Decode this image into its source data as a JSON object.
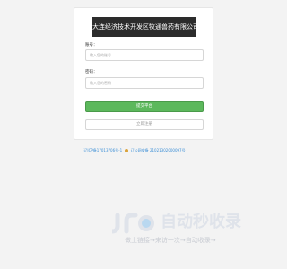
{
  "company_title": "大连经济技术开发区牧通兽药有限公司",
  "form": {
    "account_label": "账号：",
    "account_placeholder": "输入您的账号",
    "password_label": "密码：",
    "password_placeholder": "输入您的密码",
    "submit_label": "提交平台",
    "account_button_label": "立即注册"
  },
  "footer": {
    "icp_text": "辽ICP备17013706号-1",
    "police_text": "辽公网安备 21021302000097号"
  },
  "watermark": {
    "title": "自动秒收录",
    "subtitle": "做上链接→来访一次→自动收录→"
  },
  "colors": {
    "submit_button": "#5cb85c",
    "title_background": "#2c2c2c",
    "footer_link": "#3a8ed6"
  }
}
